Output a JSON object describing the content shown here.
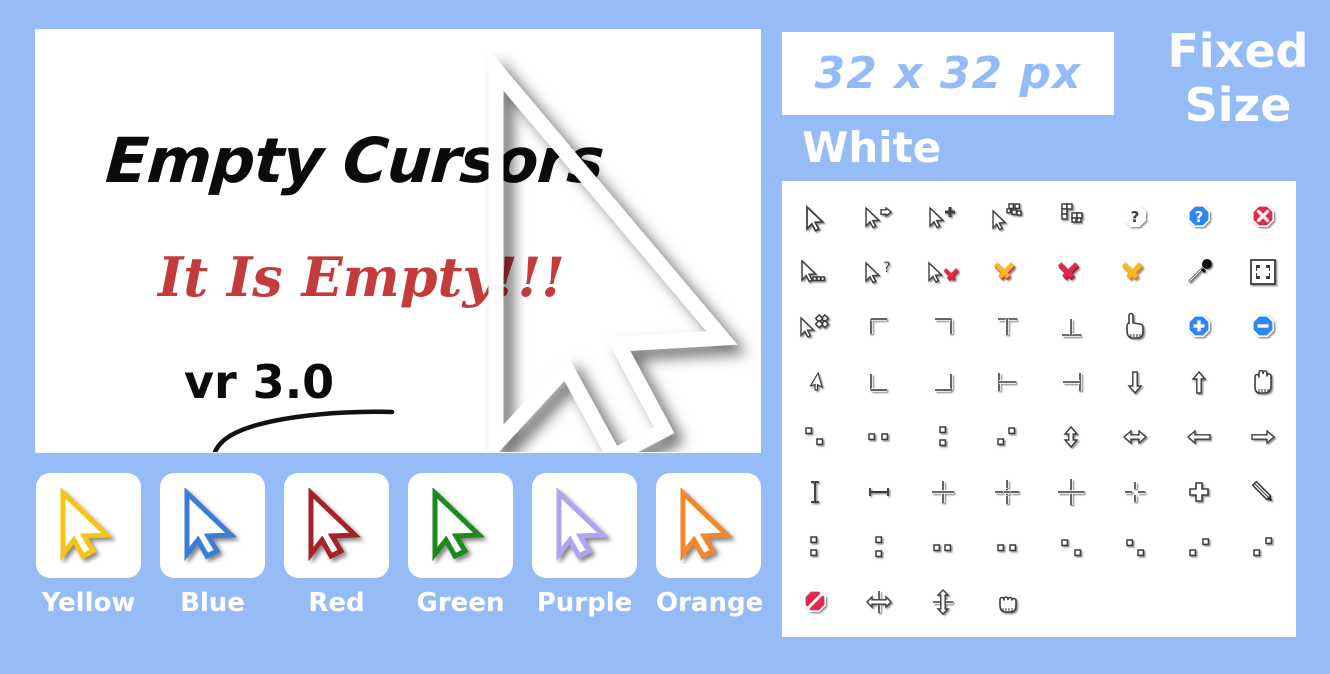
{
  "background_color": "#95bcf7",
  "hero": {
    "title": "Empty Cursors",
    "subtitle": "It Is Empty!!!",
    "version": "vr 3.0",
    "title_color": "#0b0b0b",
    "subtitle_color": "#c33b3b",
    "card_color": "#ffffff",
    "big_cursor_icon": "large-arrow-cursor-outline"
  },
  "header": {
    "size_banner": "32 x 32 px",
    "size_banner_text_color": "#93bbf7",
    "fixed_line1": "Fixed",
    "fixed_line2": "Size",
    "variant_label": "White",
    "text_color": "#ffffff"
  },
  "colors": {
    "yellow": "#f5c518",
    "blue": "#3a7bd5",
    "red": "#a52226",
    "green": "#1e8a1e",
    "purple": "#b0a5ef",
    "orange": "#f4872c",
    "white": "#ffffff",
    "shadow": "#8a8a8a",
    "ink": "#3c3c3c",
    "crimson": "#e0294b",
    "gold": "#f7b824",
    "azure": "#2f86f6"
  },
  "color_cards": [
    {
      "label": "Yellow",
      "color": "#f5c518",
      "icon": "arrow-cursor-yellow"
    },
    {
      "label": "Blue",
      "color": "#3a7bd5",
      "icon": "arrow-cursor-blue"
    },
    {
      "label": "Red",
      "color": "#a52226",
      "icon": "arrow-cursor-red"
    },
    {
      "label": "Green",
      "color": "#1e8a1e",
      "icon": "arrow-cursor-green"
    },
    {
      "label": "Purple",
      "color": "#b0a5ef",
      "icon": "arrow-cursor-purple"
    },
    {
      "label": "Orange",
      "color": "#f4872c",
      "icon": "arrow-cursor-orange"
    }
  ],
  "cursor_grid": {
    "columns": 8,
    "rows": 8,
    "count": 60,
    "panel_color": "#ffffff",
    "items": [
      {
        "name": "arrow-cursor-icon",
        "glyph": "arrow"
      },
      {
        "name": "arrow-app-starting-icon",
        "glyph": "arrow-right-arrow"
      },
      {
        "name": "arrow-plus-icon",
        "glyph": "arrow-plus"
      },
      {
        "name": "arrow-working-in-background-icon",
        "glyph": "arrow-dots-tl"
      },
      {
        "name": "busy-blocks-icon",
        "glyph": "blocks"
      },
      {
        "name": "help-octagon-outline-icon",
        "glyph": "help-outline"
      },
      {
        "name": "help-octagon-blue-icon",
        "glyph": "help-blue"
      },
      {
        "name": "unavailable-octagon-red-icon",
        "glyph": "close-red"
      },
      {
        "name": "arrow-dotted-trail-icon",
        "glyph": "arrow-dots-trail"
      },
      {
        "name": "arrow-help-question-icon",
        "glyph": "arrow-question"
      },
      {
        "name": "arrow-delete-x-icon",
        "glyph": "arrow-x"
      },
      {
        "name": "x-mark-yellow-red-icon",
        "glyph": "x-gold-red"
      },
      {
        "name": "x-mark-red-icon",
        "glyph": "x-red"
      },
      {
        "name": "x-mark-orange-icon",
        "glyph": "x-orange"
      },
      {
        "name": "eyedropper-icon",
        "glyph": "eyedropper"
      },
      {
        "name": "fit-to-frame-icon",
        "glyph": "frame-fit"
      },
      {
        "name": "arrow-move-icon",
        "glyph": "arrow-move"
      },
      {
        "name": "corner-top-left-icon",
        "glyph": "corner-tl"
      },
      {
        "name": "corner-top-right-icon",
        "glyph": "corner-tr"
      },
      {
        "name": "tee-down-icon",
        "glyph": "tee-down"
      },
      {
        "name": "tee-up-icon",
        "glyph": "tee-up"
      },
      {
        "name": "pointing-hand-icon",
        "glyph": "hand-point"
      },
      {
        "name": "zoom-in-octagon-icon",
        "glyph": "plus-blue"
      },
      {
        "name": "zoom-out-octagon-icon",
        "glyph": "minus-blue"
      },
      {
        "name": "arrow-up-left-small-icon",
        "glyph": "arrow-small"
      },
      {
        "name": "corner-bottom-left-icon",
        "glyph": "corner-bl"
      },
      {
        "name": "corner-bottom-right-icon",
        "glyph": "corner-br"
      },
      {
        "name": "tee-right-icon",
        "glyph": "tee-right"
      },
      {
        "name": "tee-left-icon",
        "glyph": "tee-left"
      },
      {
        "name": "arrow-down-icon",
        "glyph": "arr-down"
      },
      {
        "name": "arrow-up-icon",
        "glyph": "arr-up"
      },
      {
        "name": "open-hand-icon",
        "glyph": "hand-open"
      },
      {
        "name": "resize-diagonal-nwse-icon",
        "glyph": "sq-nwse"
      },
      {
        "name": "resize-horizontal-pair-icon",
        "glyph": "sq-horiz"
      },
      {
        "name": "resize-vertical-pair-icon",
        "glyph": "sq-vert"
      },
      {
        "name": "resize-diagonal-nesw-icon",
        "glyph": "sq-nesw"
      },
      {
        "name": "resize-vertical-arrow-icon",
        "glyph": "arr-ns"
      },
      {
        "name": "resize-horizontal-arrow-icon",
        "glyph": "arr-ew"
      },
      {
        "name": "arrow-left-icon",
        "glyph": "arr-left"
      },
      {
        "name": "arrow-right-icon",
        "glyph": "arr-right"
      },
      {
        "name": "text-ibeam-icon",
        "glyph": "ibeam"
      },
      {
        "name": "horizontal-ibeam-icon",
        "glyph": "ibeam-h"
      },
      {
        "name": "crosshair-plain-icon",
        "glyph": "cross1"
      },
      {
        "name": "crosshair-dashed-icon",
        "glyph": "cross2"
      },
      {
        "name": "crosshair-large-icon",
        "glyph": "cross3"
      },
      {
        "name": "crosshair-small-dashed-icon",
        "glyph": "cross4"
      },
      {
        "name": "crosshair-bold-icon",
        "glyph": "cross5"
      },
      {
        "name": "pencil-icon",
        "glyph": "pencil"
      },
      {
        "name": "resize-vertical-stack-a-icon",
        "glyph": "sq-vert2"
      },
      {
        "name": "resize-vertical-stack-b-icon",
        "glyph": "sq-vert3"
      },
      {
        "name": "resize-horizontal-pair-b-icon",
        "glyph": "sq-horiz2"
      },
      {
        "name": "resize-horizontal-pair-c-icon",
        "glyph": "sq-horiz3"
      },
      {
        "name": "resize-diagonal-a-icon",
        "glyph": "sq-d1"
      },
      {
        "name": "resize-diagonal-b-icon",
        "glyph": "sq-d2"
      },
      {
        "name": "resize-diagonal-c-icon",
        "glyph": "sq-d3"
      },
      {
        "name": "resize-diagonal-d-icon",
        "glyph": "sq-d4"
      },
      {
        "name": "no-entry-octagon-icon",
        "glyph": "no-entry"
      },
      {
        "name": "split-horizontal-icon",
        "glyph": "split-h"
      },
      {
        "name": "split-vertical-icon",
        "glyph": "split-v"
      },
      {
        "name": "grabbing-hand-icon",
        "glyph": "hand-grab"
      }
    ]
  }
}
